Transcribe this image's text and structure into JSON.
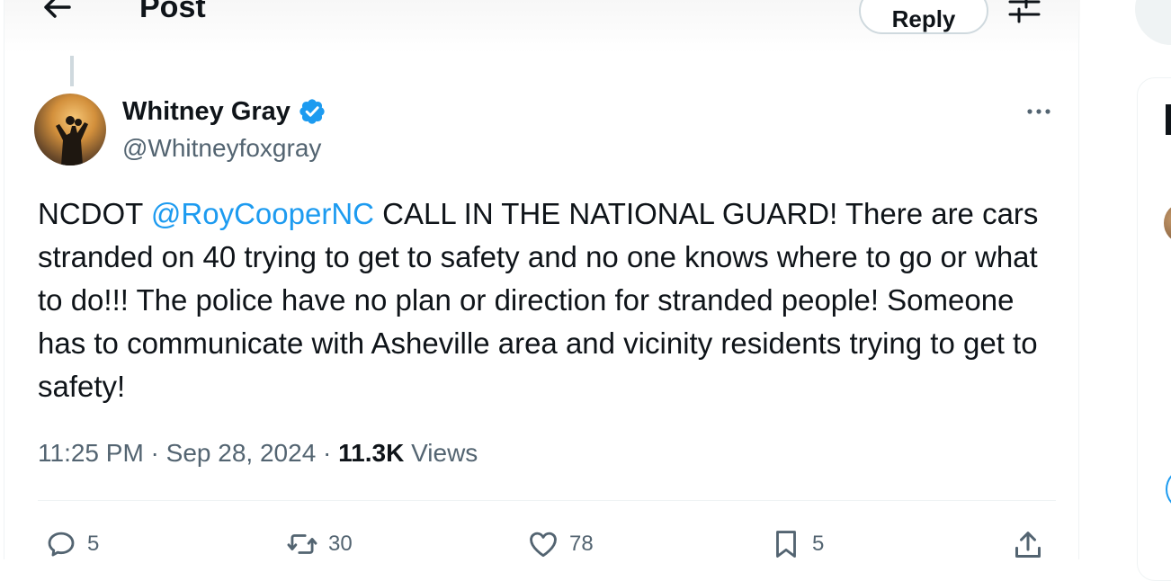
{
  "header": {
    "title": "Post",
    "reply_label": "Reply"
  },
  "post": {
    "author": {
      "name": "Whitney Gray",
      "handle": "@Whitneyfoxgray"
    },
    "text": {
      "lead": "NCDOT ",
      "mention": "@RoyCooperNC",
      "body": " CALL IN THE NATIONAL GUARD!  There are cars stranded on 40 trying to get to safety and no one knows where to go or what to do!!!  The police have no plan or direction for stranded people! Someone has to communicate with Asheville area and vicinity residents trying to get to safety!"
    },
    "meta": {
      "time": "11:25 PM",
      "sep1": " · ",
      "date": "Sep 28, 2024",
      "sep2": " · ",
      "views_count": "11.3K",
      "views_label": " Views"
    },
    "actions": {
      "replies": "5",
      "reposts": "30",
      "likes": "78",
      "bookmarks": "5"
    }
  },
  "colors": {
    "accent": "#1d9bf0",
    "text_primary": "#0f1419",
    "text_secondary": "#536471",
    "border": "#eff3f4"
  },
  "icons": {
    "back": "arrow-left-icon",
    "settings": "sliders-icon",
    "verified": "verified-badge-icon",
    "more": "more-dots-icon",
    "reply": "comment-icon",
    "repost": "repost-icon",
    "like": "heart-icon",
    "bookmark": "bookmark-icon",
    "share": "share-icon"
  }
}
